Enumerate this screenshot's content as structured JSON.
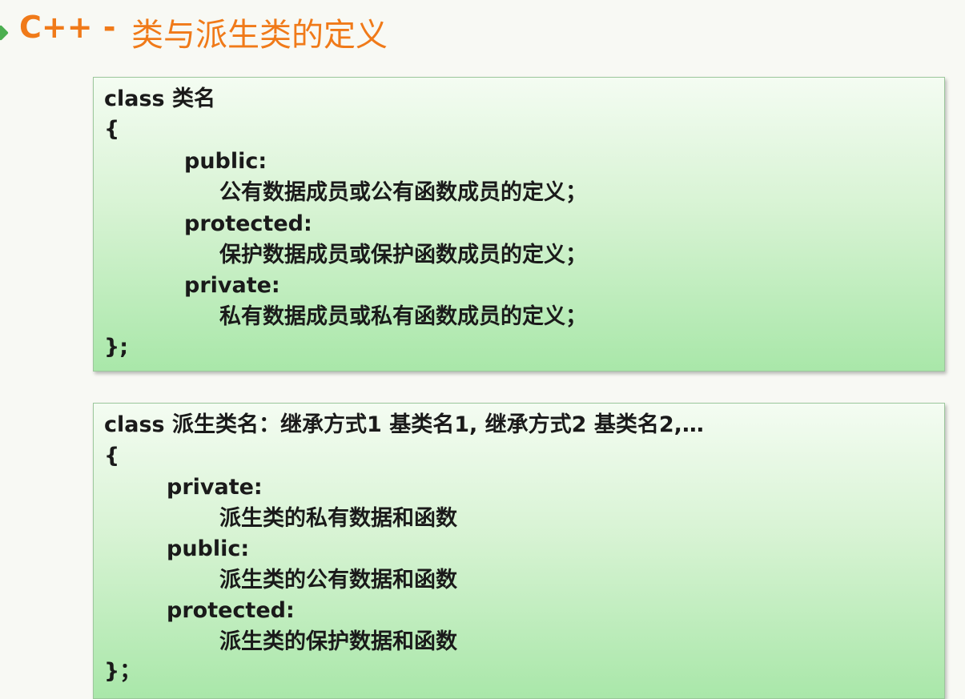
{
  "header": {
    "title_en": "C++ -",
    "title_cn": "类与派生类的定义"
  },
  "box1": {
    "lines": [
      "class 类名",
      "{",
      "public:",
      "公有数据成员或公有函数成员的定义；",
      "protected:",
      "保护数据成员或保护函数成员的定义；",
      "private:",
      "私有数据成员或私有函数成员的定义；",
      "};"
    ]
  },
  "box2": {
    "lines": [
      "class 派生类名：继承方式1  基类名1, 继承方式2   基类名2,…",
      "{",
      "private:",
      "派生类的私有数据和函数",
      "public:",
      "派生类的公有数据和函数",
      "protected:",
      "派生类的保护数据和函数",
      "}；"
    ]
  },
  "colors": {
    "title": "#f07a19",
    "bullet": "#4caf50",
    "box_top": "#f4fcf2",
    "box_bottom": "#a9e7a9",
    "code_text": "#1a1a1a"
  }
}
